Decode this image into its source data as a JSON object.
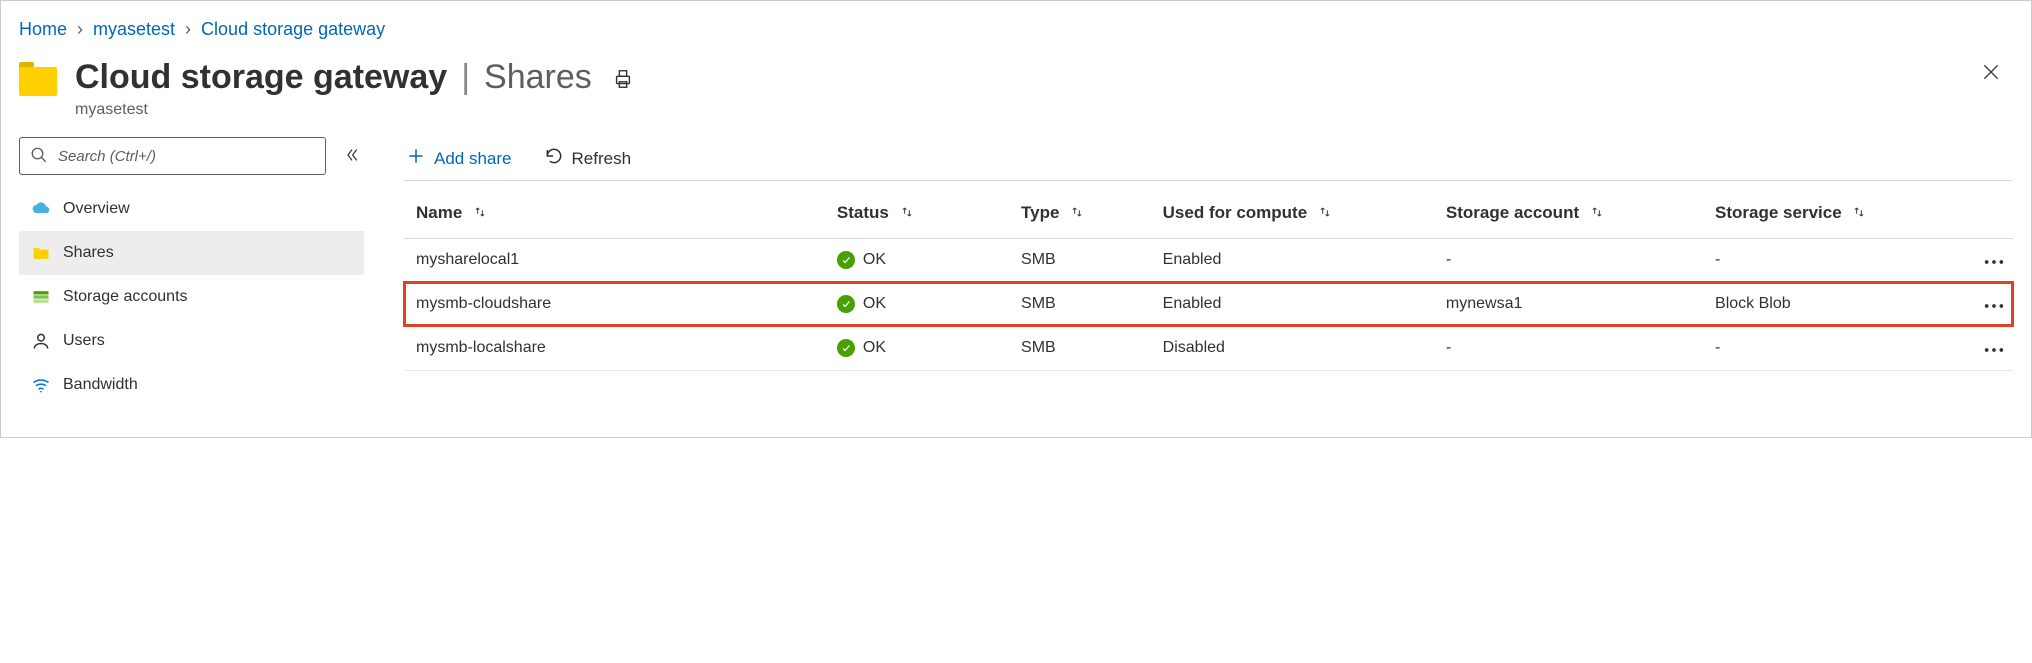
{
  "breadcrumb": [
    {
      "label": "Home"
    },
    {
      "label": "myasetest"
    },
    {
      "label": "Cloud storage gateway"
    }
  ],
  "header": {
    "resource_title": "Cloud storage gateway",
    "page_title": "Shares",
    "resource_name": "myasetest"
  },
  "search": {
    "placeholder": "Search (Ctrl+/)"
  },
  "sidebar": [
    {
      "label": "Overview",
      "icon": "cloud",
      "selected": false
    },
    {
      "label": "Shares",
      "icon": "folder",
      "selected": true
    },
    {
      "label": "Storage accounts",
      "icon": "storage",
      "selected": false
    },
    {
      "label": "Users",
      "icon": "user",
      "selected": false
    },
    {
      "label": "Bandwidth",
      "icon": "wifi",
      "selected": false
    }
  ],
  "toolbar": {
    "add_label": "Add share",
    "refresh_label": "Refresh"
  },
  "table": {
    "columns": {
      "name": "Name",
      "status": "Status",
      "type": "Type",
      "compute": "Used for compute",
      "account": "Storage account",
      "service": "Storage service"
    },
    "rows": [
      {
        "name": "mysharelocal1",
        "status": "OK",
        "type": "SMB",
        "compute": "Enabled",
        "account": "-",
        "service": "-",
        "highlight": false
      },
      {
        "name": "mysmb-cloudshare",
        "status": "OK",
        "type": "SMB",
        "compute": "Enabled",
        "account": "mynewsa1",
        "service": "Block Blob",
        "highlight": true
      },
      {
        "name": "mysmb-localshare",
        "status": "OK",
        "type": "SMB",
        "compute": "Disabled",
        "account": "-",
        "service": "-",
        "highlight": false
      }
    ]
  }
}
